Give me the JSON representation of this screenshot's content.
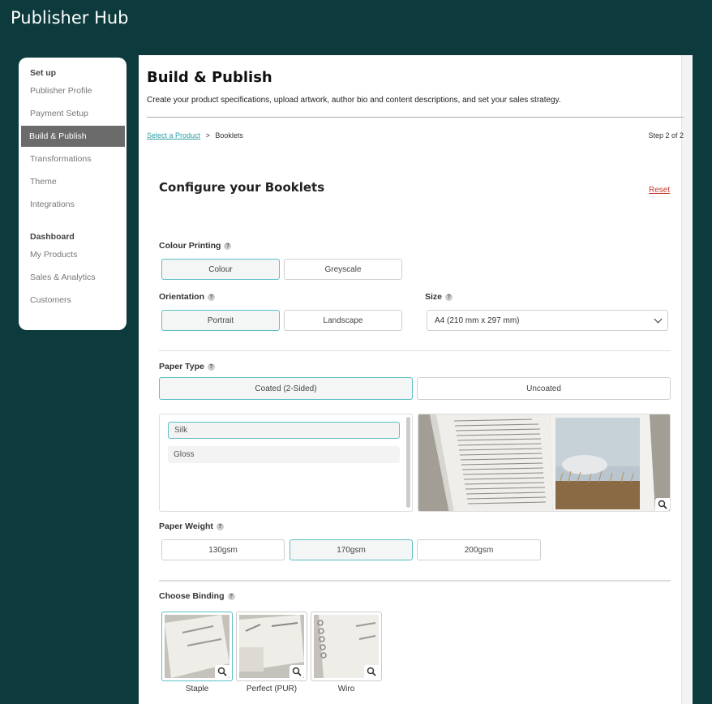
{
  "app": {
    "title": "Publisher Hub"
  },
  "sidebar": {
    "setup_heading": "Set up",
    "setup_items": [
      {
        "label": "Publisher Profile",
        "active": false
      },
      {
        "label": "Payment Setup",
        "active": false
      },
      {
        "label": "Build & Publish",
        "active": true
      },
      {
        "label": "Transformations",
        "active": false
      },
      {
        "label": "Theme",
        "active": false
      },
      {
        "label": "Integrations",
        "active": false
      }
    ],
    "dashboard_heading": "Dashboard",
    "dashboard_items": [
      {
        "label": "My Products"
      },
      {
        "label": "Sales & Analytics"
      },
      {
        "label": "Customers"
      }
    ]
  },
  "page": {
    "title": "Build & Publish",
    "subtitle": "Create your product specifications, upload artwork, author bio and content descriptions, and set your sales strategy.",
    "breadcrumb": {
      "link": "Select a Product",
      "separator": ">",
      "current": "Booklets"
    },
    "step": "Step 2 of 2"
  },
  "config": {
    "title": "Configure your Booklets",
    "reset_label": "Reset",
    "help_glyph": "?",
    "colour_printing": {
      "label": "Colour Printing",
      "options": [
        "Colour",
        "Greyscale"
      ],
      "selected": "Colour"
    },
    "orientation": {
      "label": "Orientation",
      "options": [
        "Portrait",
        "Landscape"
      ],
      "selected": "Portrait"
    },
    "size": {
      "label": "Size",
      "value": "A4 (210 mm x 297 mm)"
    },
    "paper_type": {
      "label": "Paper Type",
      "options": [
        "Coated (2-Sided)",
        "Uncoated"
      ],
      "selected": "Coated (2-Sided)"
    },
    "finish": {
      "options": [
        "Silk",
        "Gloss"
      ],
      "selected": "Silk"
    },
    "paper_weight": {
      "label": "Paper Weight",
      "options": [
        "130gsm",
        "170gsm",
        "200gsm"
      ],
      "selected": "170gsm"
    },
    "binding": {
      "label": "Choose Binding",
      "options": [
        "Staple",
        "Perfect (PUR)",
        "Wiro"
      ],
      "selected": "Staple"
    }
  },
  "colors": {
    "brand_dark": "#0d3a3c",
    "accent": "#5cbfc3",
    "link": "#2a9ea6",
    "danger": "#c0392b"
  }
}
